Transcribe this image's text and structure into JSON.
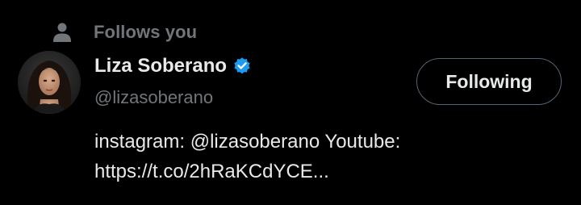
{
  "social_context": {
    "icon": "person-icon",
    "text": "Follows you"
  },
  "user": {
    "display_name": "Liza Soberano",
    "verified_icon": "verified-badge-icon",
    "handle": "@lizasoberano",
    "bio_lines": [
      "instagram: @lizasoberano Youtube:",
      "https://t.co/2hRaKCdYCE..."
    ]
  },
  "follow_button": {
    "label": "Following"
  },
  "colors": {
    "background": "#000000",
    "primary_text": "#e7e9ea",
    "secondary_text": "#71767b",
    "verified_blue": "#1d9bf0",
    "button_border": "#536471"
  }
}
